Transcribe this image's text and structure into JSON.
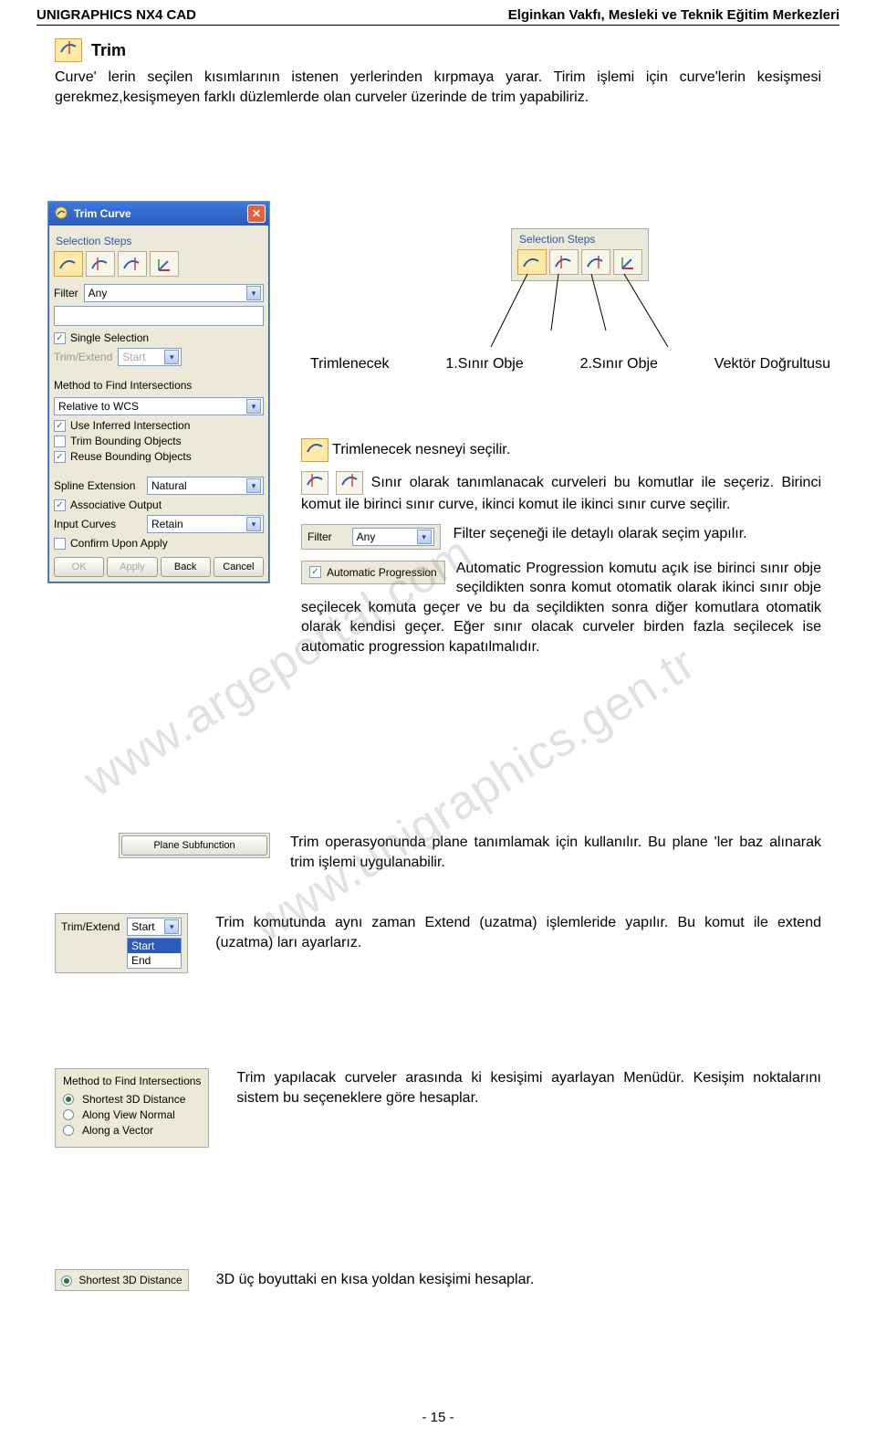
{
  "header": {
    "left": "UNIGRAPHICS NX4 CAD",
    "right": "Elginkan Vakfı, Mesleki ve Teknik Eğitim Merkezleri"
  },
  "title_row": {
    "heading": "Trim"
  },
  "intro": "Curve' lerin seçilen kısımlarının istenen yerlerinden kırpmaya yarar. Tirim işlemi için curve'lerin kesişmesi gerekmez,kesişmeyen farklı düzlemlerde olan curveler üzerinde de trim yapabiliriz.",
  "dialog": {
    "title": "Trim Curve",
    "selection_steps": "Selection Steps",
    "filter_label": "Filter",
    "filter_value": "Any",
    "single_selection": "Single Selection",
    "trim_extend_label": "Trim/Extend",
    "trim_extend_value": "Start",
    "method_label": "Method to Find Intersections",
    "rel_wcs": "Relative to WCS",
    "use_inferred": "Use Inferred Intersection",
    "trim_bounding": "Trim Bounding Objects",
    "reuse_bounding": "Reuse Bounding Objects",
    "spline_ext_label": "Spline Extension",
    "spline_ext_value": "Natural",
    "assoc_output": "Associative Output",
    "input_curves_label": "Input Curves",
    "input_curves_value": "Retain",
    "confirm_apply": "Confirm Upon Apply",
    "btn_ok": "OK",
    "btn_apply": "Apply",
    "btn_back": "Back",
    "btn_cancel": "Cancel"
  },
  "mini_selection": {
    "label": "Selection Steps"
  },
  "annotation": {
    "trimlenecek": "Trimlenecek",
    "sinir1": "1.Sınır Obje",
    "sinir2": "2.Sınır Obje",
    "vektor": "Vektör Doğrultusu"
  },
  "desc1": "Trimlenecek nesneyi seçilir.",
  "desc2": "Sınır olarak tanımlanacak curveleri bu komutlar ile seçeriz. Birinci komut ile birinci sınır curve, ikinci komut ile ikinci sınır curve seçilir.",
  "filter_block": {
    "label": "Filter",
    "value": "Any",
    "text": "Filter seçeneği ile detaylı olarak seçim yapılır."
  },
  "autoprog": {
    "label": "Automatic Progression",
    "text": "Automatic Progression komutu açık ise birinci sınır obje seçildikten sonra komut otomatik olarak ikinci sınır obje seçilecek komuta geçer ve bu da seçildikten sonra diğer komutlara otomatik olarak kendisi geçer. Eğer sınır olacak curveler birden fazla seçilecek ise automatic progression kapatılmalıdır."
  },
  "plane_sub": {
    "button": "Plane Subfunction",
    "text": "Trim operasyonunda plane tanımlamak için kullanılır. Bu plane 'ler baz alınarak trim işlemi uygulanabilir."
  },
  "trimext": {
    "label": "Trim/Extend",
    "top_value": "Start",
    "opt_start": "Start",
    "opt_end": "End",
    "text": "Trim komutunda aynı zaman Extend (uzatma) işlemleride yapılır. Bu komut ile extend (uzatma) ları ayarlarız."
  },
  "method_panel": {
    "header": "Method to Find Intersections",
    "r1": "Shortest 3D Distance",
    "r2": "Along View Normal",
    "r3": "Along a Vector",
    "text": "Trim yapılacak curveler arasında ki kesişimi ayarlayan Menüdür. Kesişim noktalarını sistem bu seçeneklere göre hesaplar."
  },
  "shortest": {
    "label": "Shortest 3D Distance",
    "text": "3D üç boyuttaki en kısa yoldan kesişimi hesaplar."
  },
  "watermarks": {
    "w1": "www.argeportal.com",
    "w2": "www.unigraphics.gen.tr"
  },
  "page_number": "- 15 -"
}
